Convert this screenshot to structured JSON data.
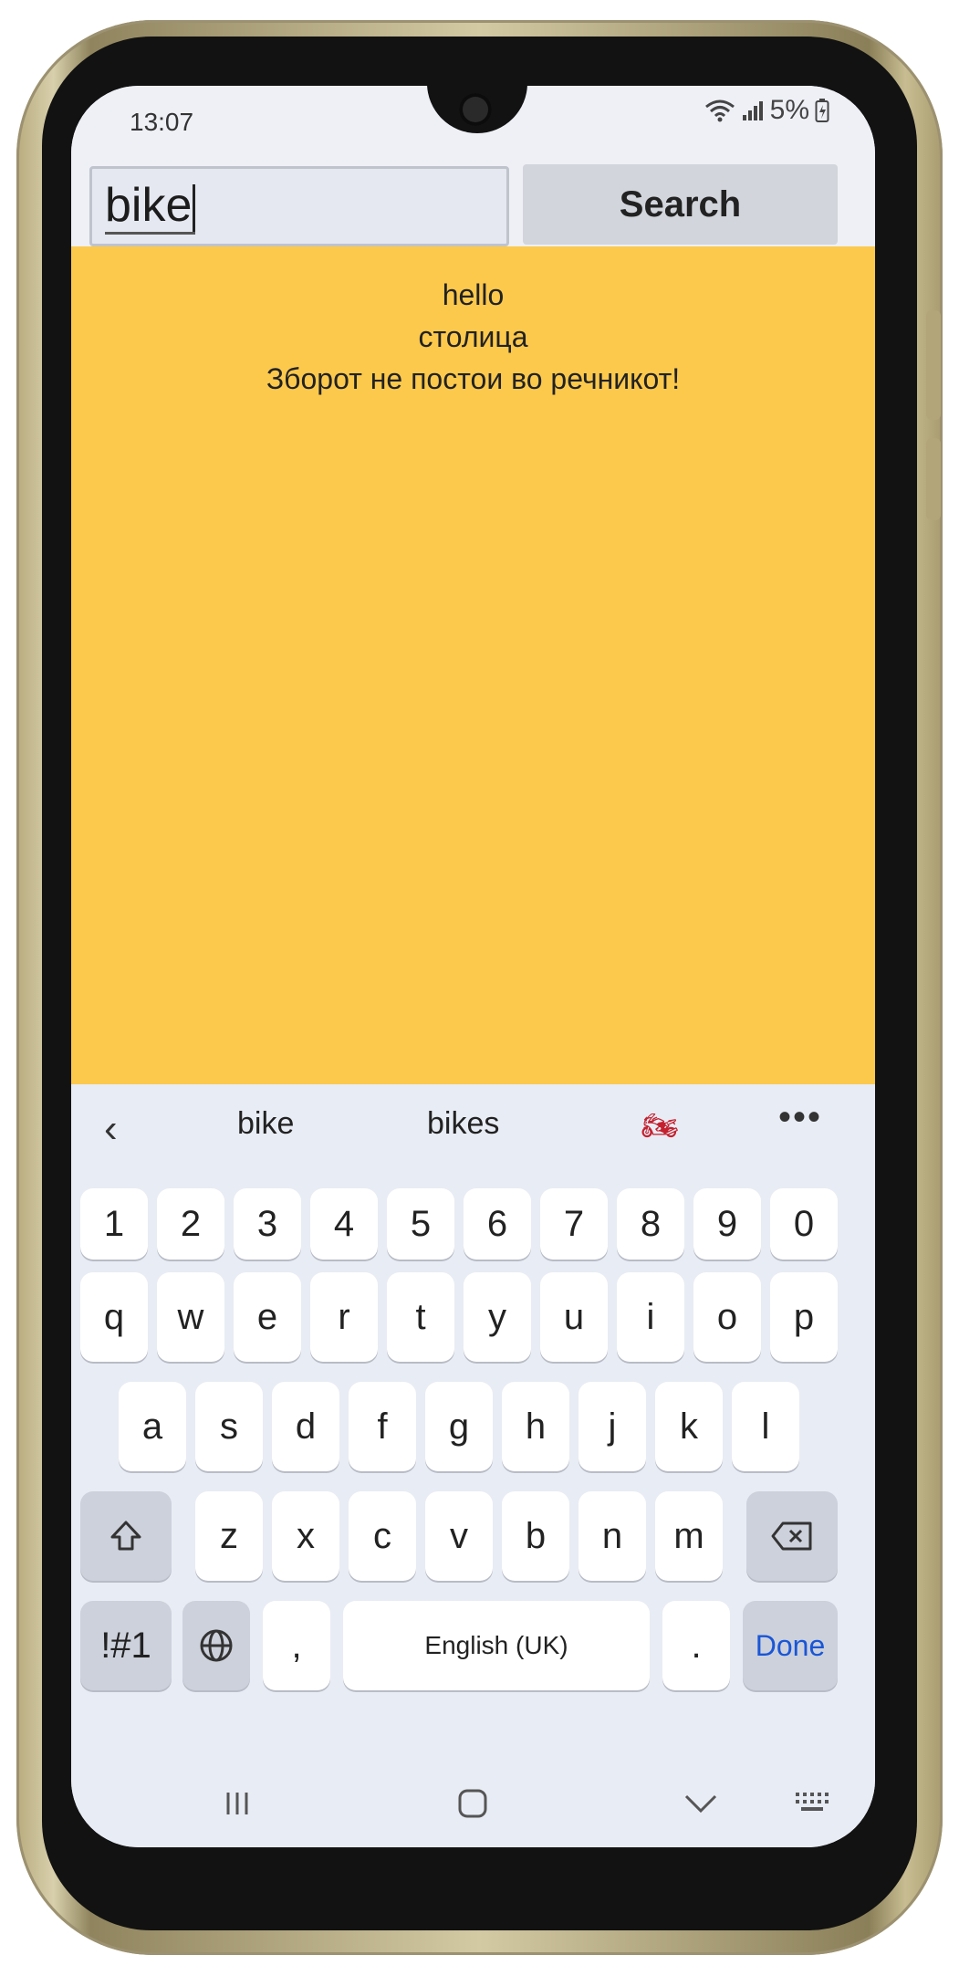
{
  "status_bar": {
    "time": "13:07",
    "battery": "5%"
  },
  "search": {
    "input_value": "bike",
    "button_label": "Search"
  },
  "results": [
    "hello",
    "столица",
    "Зборот не постои во речникот!"
  ],
  "keyboard": {
    "suggestions": [
      "bike",
      "bikes"
    ],
    "suggestion_emoji": "🏍",
    "number_row": [
      "1",
      "2",
      "3",
      "4",
      "5",
      "6",
      "7",
      "8",
      "9",
      "0"
    ],
    "row1": [
      "q",
      "w",
      "e",
      "r",
      "t",
      "y",
      "u",
      "i",
      "o",
      "p"
    ],
    "row2": [
      "a",
      "s",
      "d",
      "f",
      "g",
      "h",
      "j",
      "k",
      "l"
    ],
    "row3": [
      "z",
      "x",
      "c",
      "v",
      "b",
      "n",
      "m"
    ],
    "symbols_label": "!#1",
    "comma": ",",
    "space_label": "English (UK)",
    "period": ".",
    "done_label": "Done"
  },
  "colors": {
    "content_background": "#fcc94d",
    "done_accent": "#1a56d6"
  },
  "icons": [
    "wifi-icon",
    "signal-icon",
    "battery-icon",
    "back-chevron-icon",
    "more-icon",
    "shift-icon",
    "backspace-icon",
    "globe-icon",
    "recents-icon",
    "home-icon",
    "nav-back-icon",
    "keyboard-icon"
  ]
}
